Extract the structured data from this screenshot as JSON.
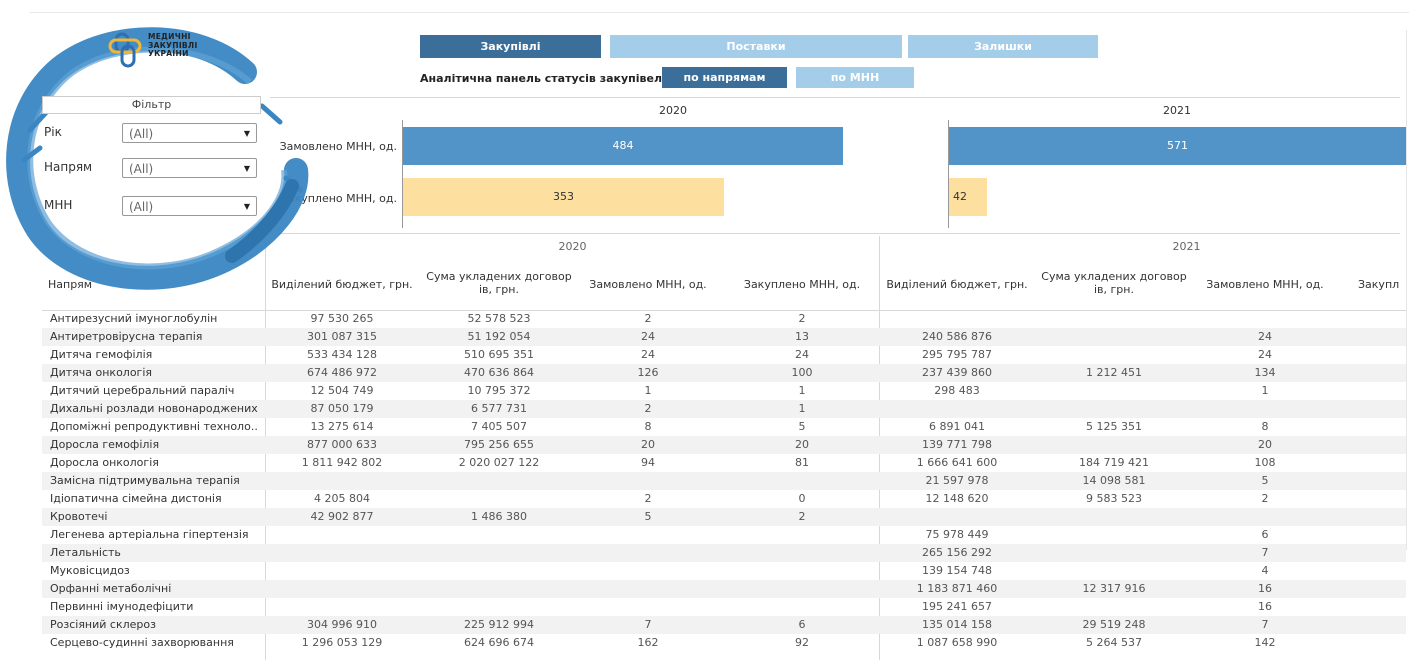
{
  "logo": {
    "text_line1": "МЕДИЧНІ",
    "text_line2": "ЗАКУПІВЛІ",
    "text_line3": "УКРАЇНИ"
  },
  "nav": {
    "tabs": [
      {
        "label": "Закупівлі",
        "color": "#3b6e99"
      },
      {
        "label": "Поставки",
        "color": "#a3cde8"
      },
      {
        "label": "Залишки",
        "color": "#a3cde8"
      }
    ]
  },
  "subnav": {
    "label": "Аналітична панель статусів закупівель:",
    "buttons": [
      {
        "label": "по напрямам"
      },
      {
        "label": "по МНН"
      }
    ]
  },
  "filter": {
    "title": "Фільтр",
    "fields": [
      {
        "label": "Рік",
        "value": "(All)"
      },
      {
        "label": "Напрям",
        "value": "(All)"
      },
      {
        "label": "МНН",
        "value": "(All)"
      }
    ]
  },
  "colors": {
    "ordered_bar": "#5294c8",
    "purchased_bar": "#fde0a0",
    "nav_active": "#3b6e99",
    "nav_inactive": "#a3cde8",
    "brand_ring": "#3a86c2"
  },
  "chart_data": {
    "type": "bar",
    "orientation": "horizontal",
    "categories": [
      "Замовлено МНН, од.",
      "Закуплено МНН, од."
    ],
    "panels": [
      {
        "year": "2020",
        "values": [
          484,
          353
        ]
      },
      {
        "year": "2021",
        "values": [
          571,
          42
        ]
      }
    ]
  },
  "table": {
    "name_header": "Напрям",
    "years": [
      "2020",
      "2021"
    ],
    "columns": [
      "Виділений бюджет, грн.",
      "Сума укладених договор ів, грн.",
      "Замовлено МНН, од.",
      "Закуплено МНН, од."
    ],
    "column_2021_cut": "Закупл",
    "rows": [
      {
        "name": "Антирезусний імуноглобулін",
        "y2020": [
          "97 530 265",
          "52 578 523",
          "2",
          "2"
        ],
        "y2021": [
          "",
          "",
          "",
          ""
        ]
      },
      {
        "name": "Антиретровірусна терапія",
        "y2020": [
          "301 087 315",
          "51 192 054",
          "24",
          "13"
        ],
        "y2021": [
          "240 586 876",
          "",
          "24",
          ""
        ]
      },
      {
        "name": "Дитяча гемофілія",
        "y2020": [
          "533 434 128",
          "510 695 351",
          "24",
          "24"
        ],
        "y2021": [
          "295 795 787",
          "",
          "24",
          ""
        ]
      },
      {
        "name": "Дитяча онкологія",
        "y2020": [
          "674 486 972",
          "470 636 864",
          "126",
          "100"
        ],
        "y2021": [
          "237 439 860",
          "1 212 451",
          "134",
          ""
        ]
      },
      {
        "name": "Дитячий церебральний параліч",
        "y2020": [
          "12 504 749",
          "10 795 372",
          "1",
          "1"
        ],
        "y2021": [
          "298 483",
          "",
          "1",
          ""
        ]
      },
      {
        "name": "Дихальні розлади новонароджених",
        "y2020": [
          "87 050 179",
          "6 577 731",
          "2",
          "1"
        ],
        "y2021": [
          "",
          "",
          "",
          ""
        ]
      },
      {
        "name": "Допоміжні репродуктивні техноло..",
        "y2020": [
          "13 275 614",
          "7 405 507",
          "8",
          "5"
        ],
        "y2021": [
          "6 891 041",
          "5 125 351",
          "8",
          ""
        ]
      },
      {
        "name": "Доросла гемофілія",
        "y2020": [
          "877 000 633",
          "795 256 655",
          "20",
          "20"
        ],
        "y2021": [
          "139 771 798",
          "",
          "20",
          ""
        ]
      },
      {
        "name": "Доросла онкологія",
        "y2020": [
          "1 811 942 802",
          "2 020 027 122",
          "94",
          "81"
        ],
        "y2021": [
          "1 666 641 600",
          "184 719 421",
          "108",
          ""
        ]
      },
      {
        "name": "Замісна підтримувальна терапія",
        "y2020": [
          "",
          "",
          "",
          ""
        ],
        "y2021": [
          "21 597 978",
          "14 098 581",
          "5",
          ""
        ]
      },
      {
        "name": "Ідіопатична сімейна дистонія",
        "y2020": [
          "4 205 804",
          "",
          "2",
          "0"
        ],
        "y2021": [
          "12 148 620",
          "9 583 523",
          "2",
          ""
        ]
      },
      {
        "name": "Кровотечі",
        "y2020": [
          "42 902 877",
          "1 486 380",
          "5",
          "2"
        ],
        "y2021": [
          "",
          "",
          "",
          ""
        ]
      },
      {
        "name": "Легенева артеріальна гіпертензія",
        "y2020": [
          "",
          "",
          "",
          ""
        ],
        "y2021": [
          "75 978 449",
          "",
          "6",
          ""
        ]
      },
      {
        "name": "Летальність",
        "y2020": [
          "",
          "",
          "",
          ""
        ],
        "y2021": [
          "265 156 292",
          "",
          "7",
          ""
        ]
      },
      {
        "name": "Муковісцидоз",
        "y2020": [
          "",
          "",
          "",
          ""
        ],
        "y2021": [
          "139 154 748",
          "",
          "4",
          ""
        ]
      },
      {
        "name": "Орфанні метаболічні",
        "y2020": [
          "",
          "",
          "",
          ""
        ],
        "y2021": [
          "1 183 871 460",
          "12 317 916",
          "16",
          ""
        ]
      },
      {
        "name": "Первинні імунодефіцити",
        "y2020": [
          "",
          "",
          "",
          ""
        ],
        "y2021": [
          "195 241 657",
          "",
          "16",
          ""
        ]
      },
      {
        "name": "Розсіяний склероз",
        "y2020": [
          "304 996 910",
          "225 912 994",
          "7",
          "6"
        ],
        "y2021": [
          "135 014 158",
          "29 519 248",
          "7",
          ""
        ]
      },
      {
        "name": "Серцево-судинні захворювання",
        "y2020": [
          "1 296 053 129",
          "624 696 674",
          "162",
          "92"
        ],
        "y2021": [
          "1 087 658 990",
          "5 264 537",
          "142",
          ""
        ]
      }
    ]
  }
}
